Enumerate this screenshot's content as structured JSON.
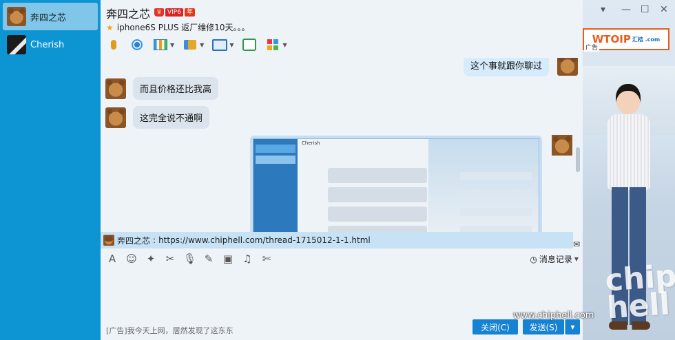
{
  "sidebar": {
    "contacts": [
      {
        "name": "奔四之芯",
        "active": true
      },
      {
        "name": "Cherish",
        "active": false
      }
    ]
  },
  "header": {
    "title": "奔四之芯",
    "vip_badge": "VIP6",
    "year_badge": "年",
    "signature": "iphone6S PLUS 返厂维修10天。。。",
    "window_controls": [
      "▾",
      "—",
      "☐",
      "✕"
    ]
  },
  "toolbar": {
    "icons": [
      "microphone-icon",
      "webcam-icon",
      "chart-icon",
      "file-transfer-icon",
      "screen-share-icon",
      "add-app-icon",
      "apps-grid-icon"
    ]
  },
  "messages": [
    {
      "direction": "out",
      "text": "这个事就跟你聊过"
    },
    {
      "direction": "in",
      "text": "而且价格还比我高"
    },
    {
      "direction": "in",
      "text": "这完全说不通啊"
    },
    {
      "direction": "out",
      "type": "image",
      "text": "Cherish"
    }
  ],
  "link_preview": {
    "sender": "奔四之芯",
    "separator": ":",
    "url": "https://www.chiphell.com/thread-1715012-1-1.html"
  },
  "input_toolbar": {
    "icons": [
      "font-icon",
      "emoji-icon",
      "shake-icon",
      "screenshot-icon",
      "voice-icon",
      "edit-icon",
      "image-icon",
      "music-icon",
      "scissors-icon"
    ],
    "history_label": "消息记录"
  },
  "footer": {
    "ad_text": "[广告]我今天上网，居然发现了这东东",
    "close_label": "关闭(C)",
    "send_label": "发送(S)",
    "send_arrow": "▾"
  },
  "ad_panel": {
    "banner_text": "WTOIP",
    "banner_sub": "汇桔 .com",
    "banner_tag": "广告",
    "watermark_url": "www.chiphell.com"
  },
  "colors": {
    "sidebar": "#0d95d3",
    "accent": "#1582d3",
    "bubble_in": "#dbe4ec",
    "bubble_out": "#d6ebfb"
  }
}
